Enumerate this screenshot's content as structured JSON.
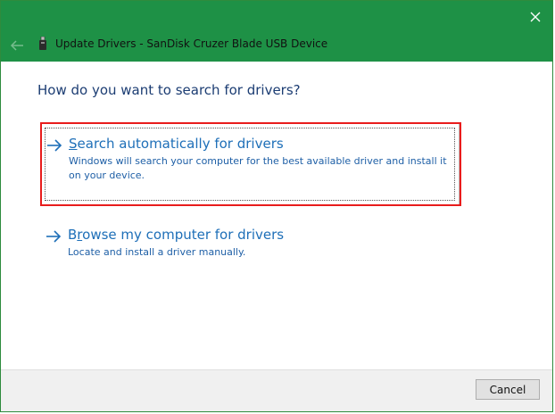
{
  "window": {
    "title": "Update Drivers - SanDisk Cruzer Blade USB Device",
    "accent_color": "#1e9146",
    "icons": {
      "close": "close-icon",
      "back": "back-arrow-icon",
      "device": "usb-drive-icon"
    }
  },
  "main": {
    "heading": "How do you want to search for drivers?",
    "options": [
      {
        "title": "Search automatically for drivers",
        "description": "Windows will search your computer for the best available driver and install it on your device.",
        "icon": "arrow-right-icon",
        "highlighted": true
      },
      {
        "title": "Browse my computer for drivers",
        "description": "Locate and install a driver manually.",
        "icon": "arrow-right-icon",
        "highlighted": false
      }
    ]
  },
  "footer": {
    "cancel_label": "Cancel"
  }
}
